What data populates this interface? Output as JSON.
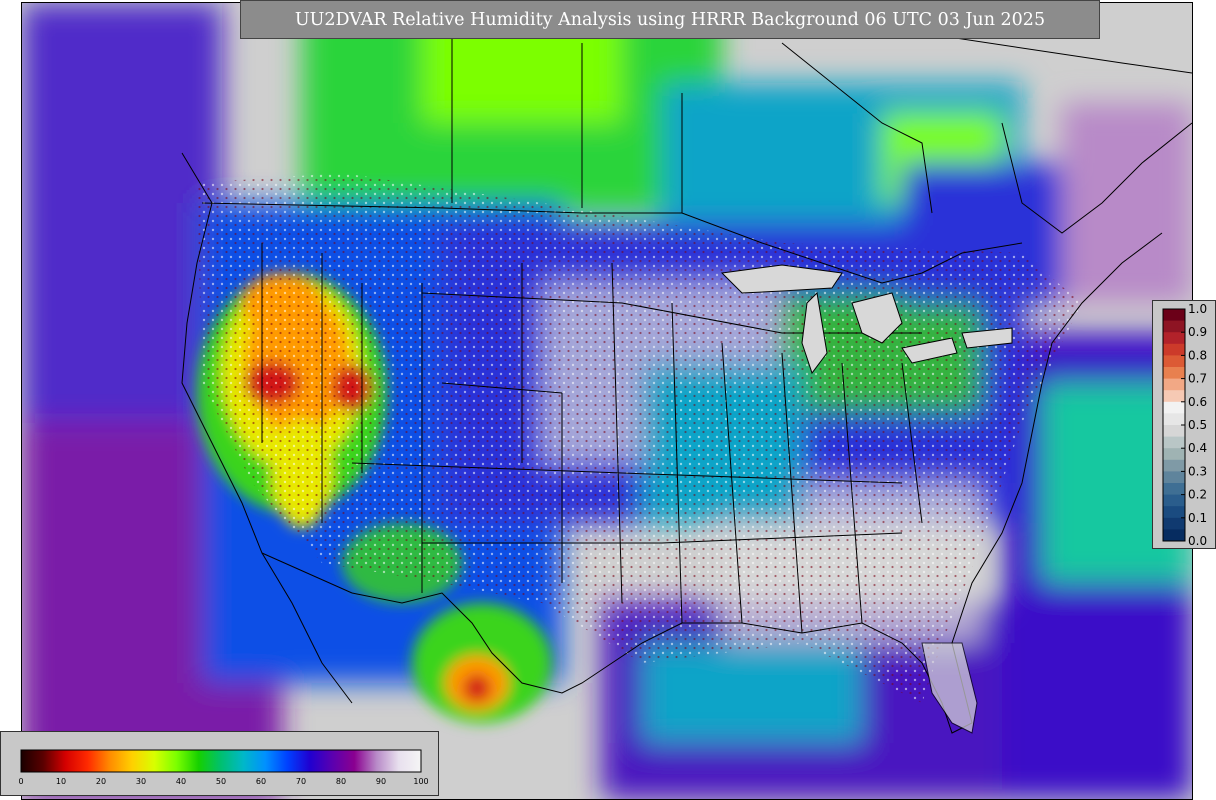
{
  "title": "UU2DVAR Relative Humidity Analysis using HRRR Background 06 UTC 03 Jun 2025",
  "rh_colorbar": {
    "ticks": [
      "0",
      "10",
      "20",
      "30",
      "40",
      "50",
      "60",
      "70",
      "80",
      "90",
      "100"
    ],
    "stops": [
      "#1a0000",
      "#5a0000",
      "#d40000",
      "#ff2a00",
      "#ff8c00",
      "#ffd000",
      "#d8ff00",
      "#7bff00",
      "#16d000",
      "#00c070",
      "#00b8c8",
      "#0090ff",
      "#0040ff",
      "#2000d0",
      "#5a00b0",
      "#8a0090",
      "#b88ac8",
      "#e8e0ee",
      "#f5f5f5"
    ]
  },
  "ratio_colorbar": {
    "ticks": [
      "1.0",
      "0.9",
      "0.8",
      "0.7",
      "0.6",
      "0.5",
      "0.4",
      "0.3",
      "0.2",
      "0.1",
      "0.0"
    ],
    "colors": [
      "#6b0018",
      "#8e1423",
      "#b2222a",
      "#cc3a2a",
      "#dc5a35",
      "#e8804f",
      "#f2a885",
      "#f6c9b4",
      "#f2f2f2",
      "#e6e6e6",
      "#d6d6d6",
      "#b9c6c6",
      "#9fb3b3",
      "#7f9aa6",
      "#5f849c",
      "#3f6f94",
      "#2a5d8c",
      "#1a4b80",
      "#103a70",
      "#062c60"
    ]
  },
  "map_colors": {
    "background": "#cfcfcf",
    "ocean_moist": "#3a10c8",
    "ocean_very_moist": "#7a1aa8",
    "dry_core": "#d11414",
    "arid": "#ff9a00",
    "semi_arid": "#e8e800",
    "moderate": "#3ad41a",
    "humid": "#0aa4c8",
    "very_humid": "#1050e6",
    "saturated": "#d8d8d8"
  }
}
